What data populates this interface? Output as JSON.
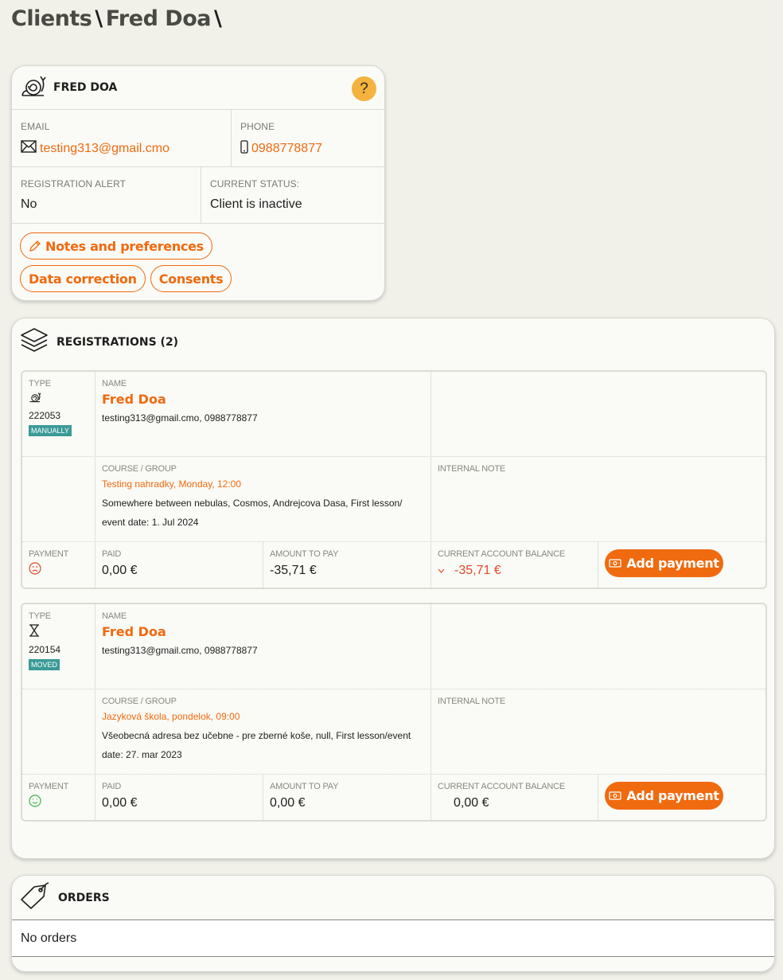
{
  "breadcrumb": {
    "part1": "Clients",
    "sep": "\\",
    "part2": "Fred Doa",
    "sep2": "\\"
  },
  "client": {
    "name": "FRED DOA",
    "help": "?",
    "email_label": "EMAIL",
    "email": "testing313@gmail.cmo",
    "phone_label": "PHONE",
    "phone": "0988778877",
    "reg_alert_label": "REGISTRATION ALERT",
    "reg_alert": "No",
    "status_label": "CURRENT STATUS:",
    "status": "Client is inactive",
    "buttons": {
      "notes": "Notes and preferences",
      "data": "Data correction",
      "consents": "Consents"
    }
  },
  "registrations": {
    "title": "REGISTRATIONS (2)",
    "labels": {
      "type": "TYPE",
      "name": "NAME",
      "course": "COURSE / GROUP",
      "note": "INTERNAL NOTE",
      "payment": "PAYMENT",
      "paid": "PAID",
      "amount": "AMOUNT TO PAY",
      "balance": "CURRENT ACCOUNT BALANCE",
      "add_payment": "Add payment"
    },
    "items": [
      {
        "id": "222053",
        "badge": "MANUALLY",
        "type_icon": "snail-icon",
        "name": "Fred Doa",
        "contact": "testing313@gmail.cmo, 0988778877",
        "course": "Testing nahradky, Monday, 12:00",
        "course_detail_1": "Somewhere between nebulas, Cosmos, Andrejcova Dasa, First lesson/",
        "course_detail_2": "event date: 1. Jul 2024",
        "payment_icon": "sad-face-icon",
        "paid": "0,00 €",
        "amount": "-35,71 €",
        "balance": "-35,71 €"
      },
      {
        "id": "220154",
        "badge": "MOVED",
        "type_icon": "hourglass-icon",
        "name": "Fred Doa",
        "contact": "testing313@gmail.cmo, 0988778877",
        "course": "Jazyková škola, pondelok, 09:00",
        "course_detail_1": "Všeobecná adresa bez učebne - pre zberné koše, null, First lesson/event",
        "course_detail_2": "date: 27. mar 2023",
        "payment_icon": "happy-face-icon",
        "paid": "0,00 €",
        "amount": "0,00 €",
        "balance": "0,00 €"
      }
    ]
  },
  "orders": {
    "title": "ORDERS",
    "empty": "No orders"
  },
  "colors": {
    "accent": "#f06a0f",
    "help": "#f4b23e",
    "badge": "#3a9a97",
    "sad": "#e04b2a",
    "happy": "#3bb54a"
  }
}
